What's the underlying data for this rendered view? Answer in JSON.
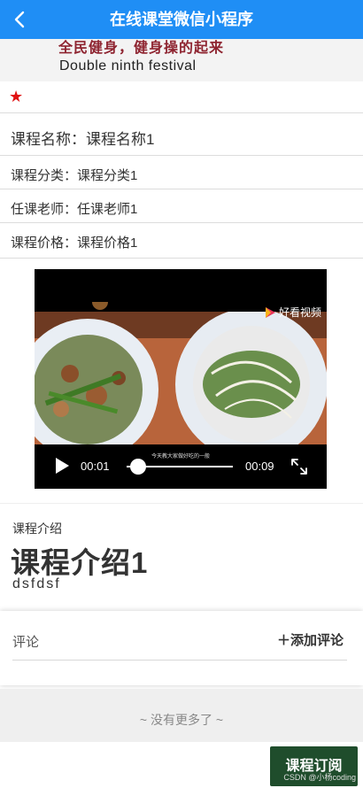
{
  "header": {
    "title": "在线课堂微信小程序"
  },
  "banner": {
    "title_cut": "全民健身，健身操的起来",
    "subtitle": "Double ninth festival"
  },
  "course": {
    "name": "课程名称：课程名称1",
    "category": "课程分类：课程分类1",
    "teacher": "任课老师：任课老师1",
    "price": "课程价格：课程价格1"
  },
  "video": {
    "current_time": "00:01",
    "duration": "00:09",
    "progress": 0.11,
    "watermark": "好看视频",
    "subtitle": "今天教大家做好吃的一般"
  },
  "intro": {
    "label": "课程介绍",
    "title": "课程介绍1",
    "text": "dsfdsf"
  },
  "comments": {
    "label": "评论",
    "add_label": "添加评论"
  },
  "footer": {
    "no_more": "~ 没有更多了 ~",
    "subscribe_label": "课程订阅",
    "credit": "CSDN @小杨coding"
  },
  "icons": {
    "back": "chevron-left-icon",
    "required": "star-icon",
    "play": "play-icon",
    "fullscreen": "fullscreen-icon",
    "add": "plus-icon"
  },
  "colors": {
    "nav": "#1f8ef5",
    "star": "#e01111",
    "subscribe": "#1f4d2c"
  }
}
